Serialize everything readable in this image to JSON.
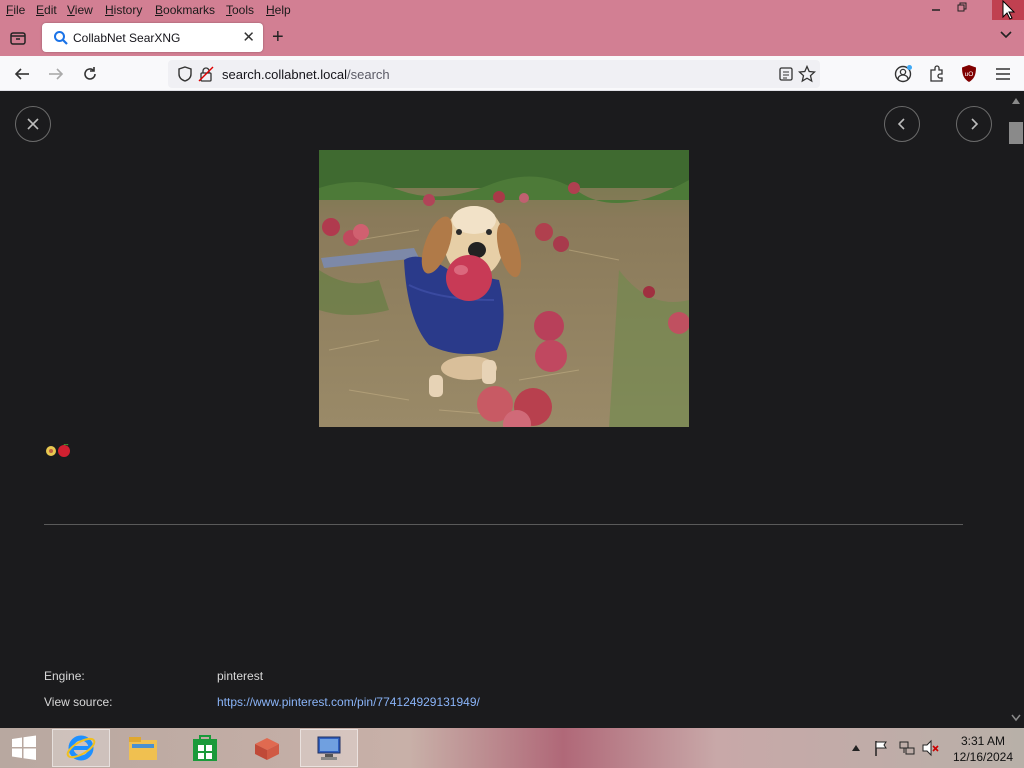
{
  "menu": {
    "items": [
      "File",
      "Edit",
      "View",
      "History",
      "Bookmarks",
      "Tools",
      "Help"
    ]
  },
  "tab": {
    "title": "CollabNet SearXNG"
  },
  "address": {
    "host": "search.collabnet.local",
    "path": "/search"
  },
  "detail": {
    "engine_label": "Engine:",
    "engine_value": "pinterest",
    "source_label": "View source:",
    "source_url": "https://www.pinterest.com/pin/774124929131949/"
  },
  "taskbar": {
    "time": "3:31 AM",
    "date": "12/16/2024"
  },
  "colors": {
    "chrome": "#d27f93",
    "content_bg": "#1b1b1d",
    "link": "#8ab4f8"
  }
}
